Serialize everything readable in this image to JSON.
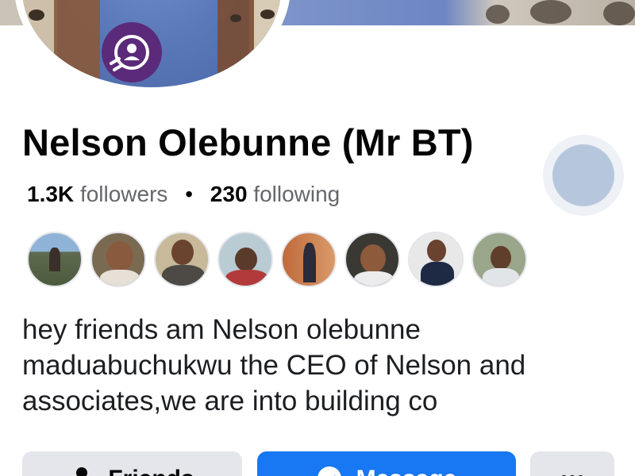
{
  "profile": {
    "name": "Nelson Olebunne (Mr BT)",
    "followers_count": "1.3K",
    "followers_label": "followers",
    "separator": "•",
    "following_count": "230",
    "following_label": "following",
    "bio": "hey friends am Nelson olebunne maduabuchukwu the CEO of Nelson and associates,we are into building co"
  },
  "friends_preview": [
    {
      "icon": "friend-avatar"
    },
    {
      "icon": "friend-avatar"
    },
    {
      "icon": "friend-avatar"
    },
    {
      "icon": "friend-avatar"
    },
    {
      "icon": "friend-avatar"
    },
    {
      "icon": "friend-avatar"
    },
    {
      "icon": "friend-avatar"
    },
    {
      "icon": "friend-avatar"
    }
  ],
  "actions": {
    "friends_label": "Friends",
    "message_label": "Message"
  },
  "colors": {
    "accent": "#1877f2",
    "badge": "#5b2a7a",
    "muted_text": "#65676b"
  }
}
